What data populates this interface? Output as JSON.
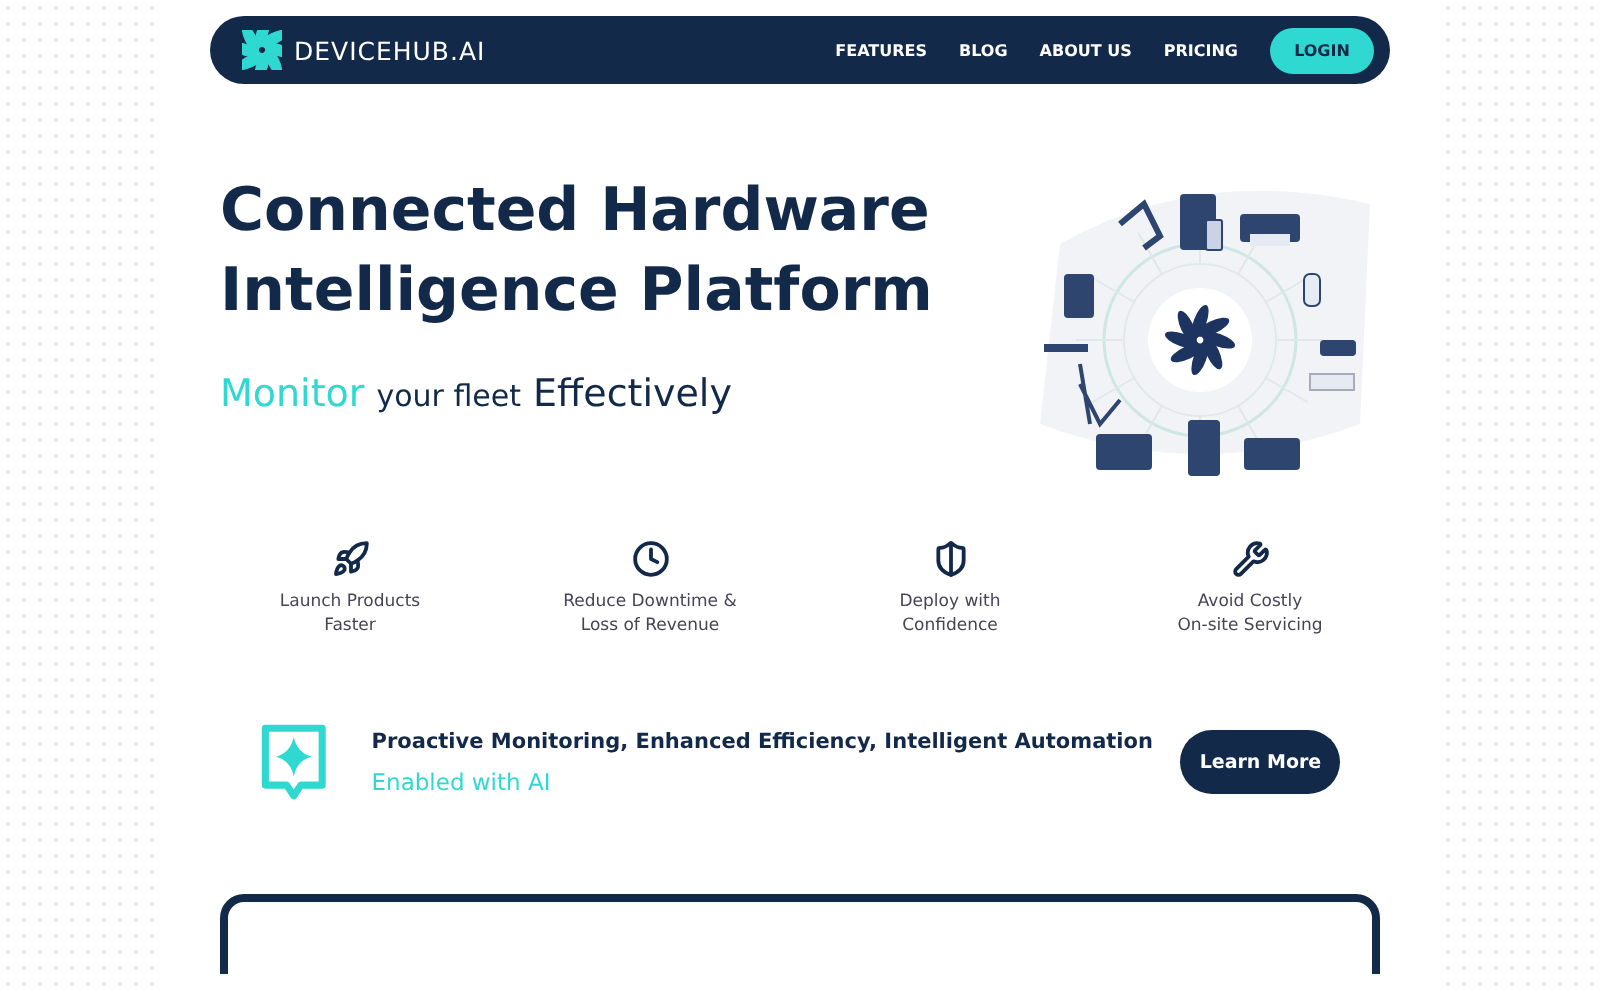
{
  "nav": {
    "brand": "DEVICEHUB.AI",
    "links": [
      "FEATURES",
      "BLOG",
      "ABOUT US",
      "PRICING"
    ],
    "login": "LOGIN"
  },
  "hero": {
    "title_lines": [
      "Connected Hardware",
      "Intelligence Platform"
    ],
    "tagline": [
      {
        "text": "Monitor",
        "kind": "accent"
      },
      {
        "text": "your fleet",
        "kind": "small"
      },
      {
        "text": "Effectively",
        "kind": "strong"
      }
    ]
  },
  "features": [
    {
      "lines": [
        "Launch Products",
        "Faster"
      ]
    },
    {
      "lines": [
        "Reduce Downtime &",
        "Loss of Revenue"
      ]
    },
    {
      "lines": [
        "Deploy with",
        "Confidence"
      ]
    },
    {
      "lines": [
        "Avoid Costly",
        "On-site Servicing"
      ]
    }
  ],
  "banner": {
    "headline": "Proactive Monitoring, Enhanced Efficiency, Intelligent Automation",
    "subline": "Enabled with AI",
    "button": "Learn More"
  }
}
